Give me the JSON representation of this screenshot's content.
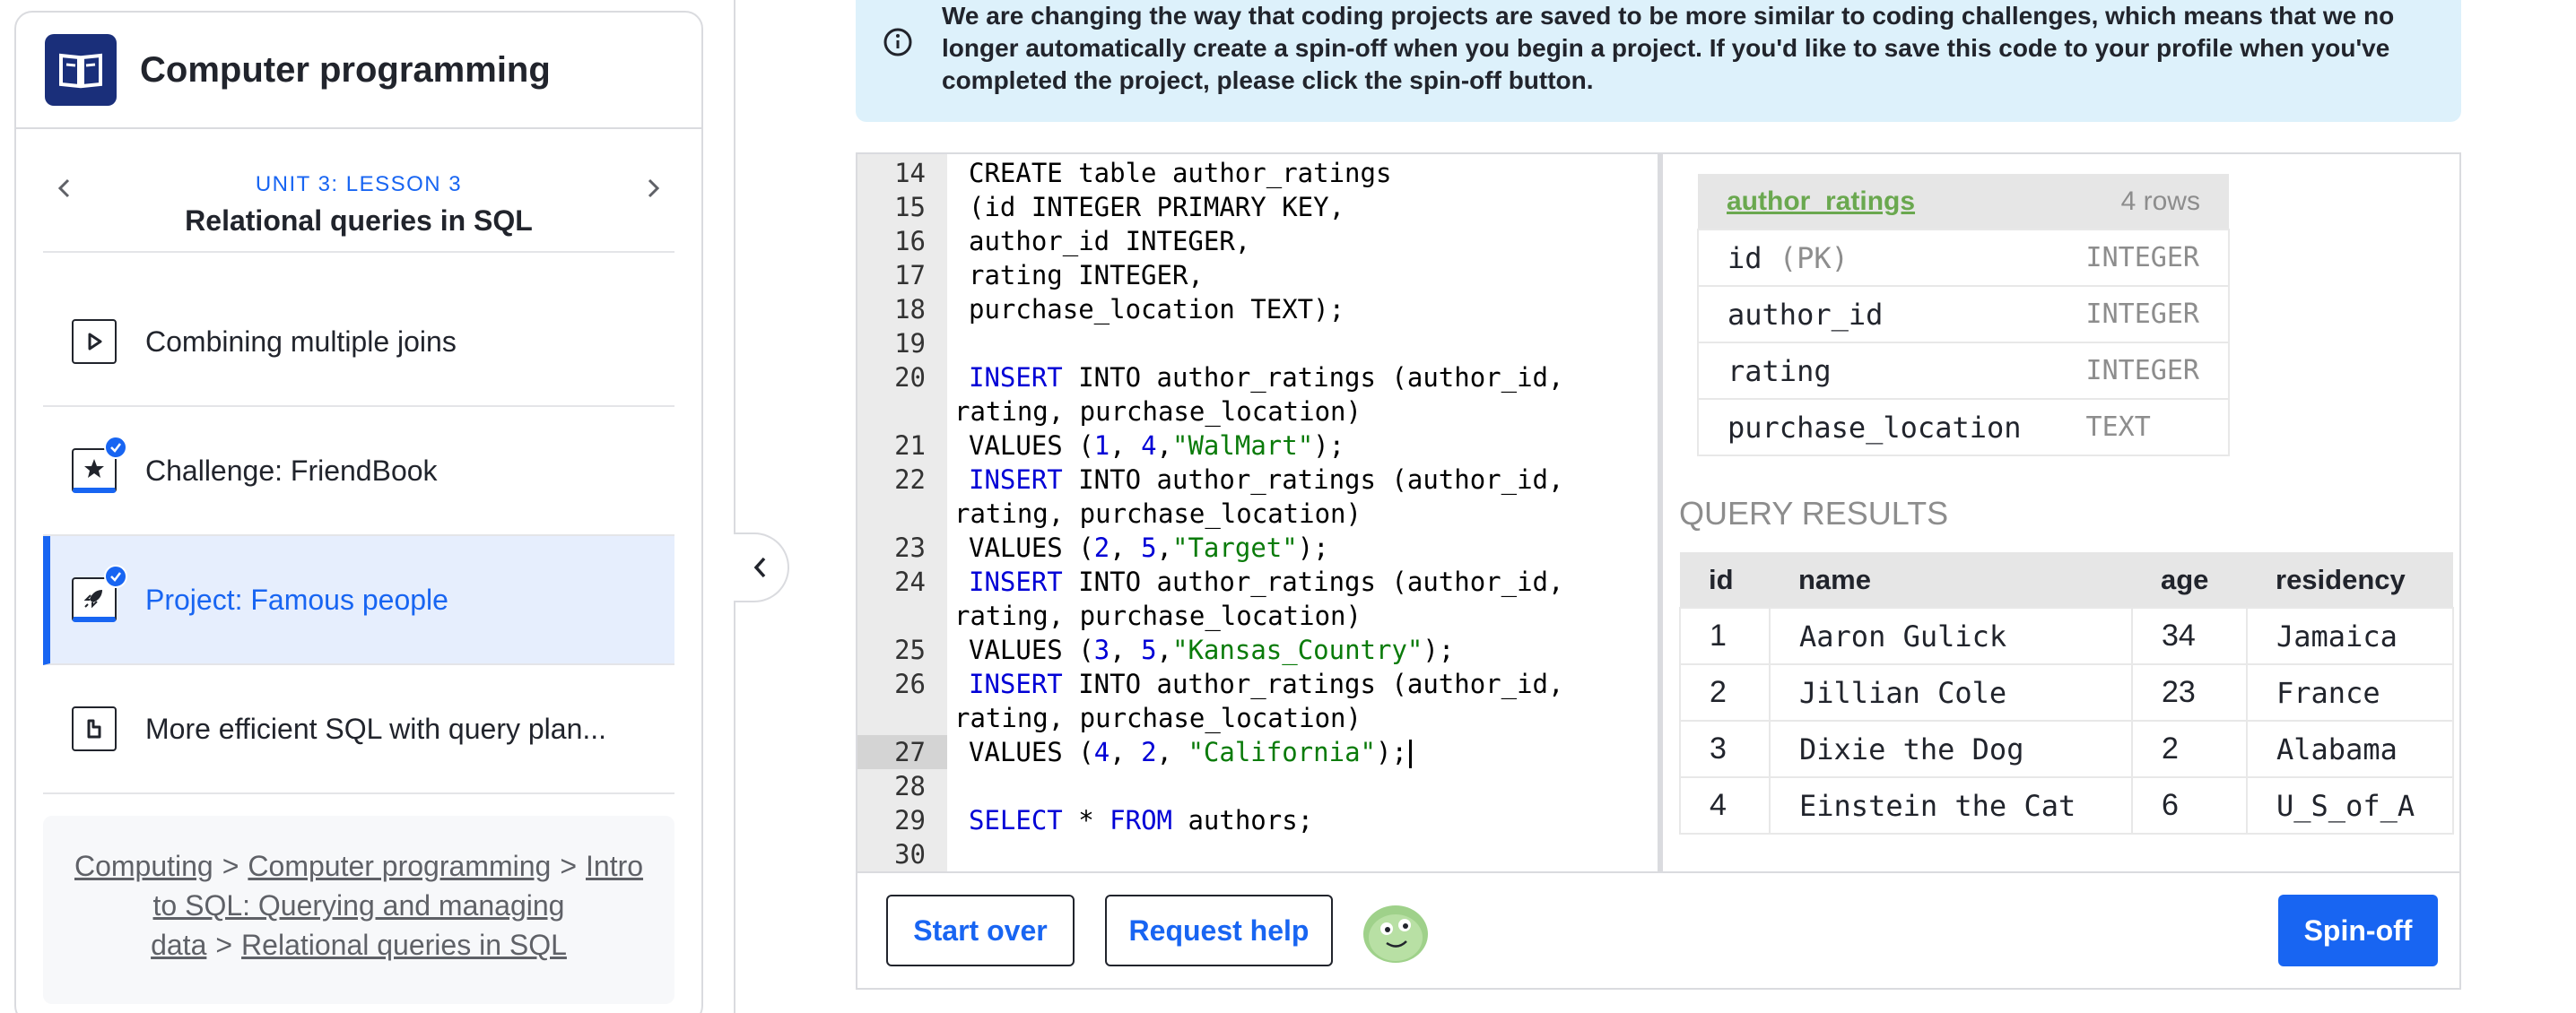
{
  "course": {
    "title": "Computer programming"
  },
  "lesson_nav": {
    "unit_label": "UNIT 3: LESSON 3",
    "lesson_title": "Relational queries in SQL"
  },
  "lessons": [
    {
      "label": "Combining multiple joins",
      "icon": "play-icon",
      "completed": false,
      "active": false
    },
    {
      "label": "Challenge: FriendBook",
      "icon": "star-icon",
      "completed": true,
      "active": false
    },
    {
      "label": "Project: Famous people",
      "icon": "rocket-icon",
      "completed": true,
      "active": true
    },
    {
      "label": "More efficient SQL with query plan...",
      "icon": "article-icon",
      "completed": false,
      "active": false
    }
  ],
  "breadcrumbs": {
    "items": [
      "Computing",
      "Computer programming",
      "Intro to SQL: Querying and managing data",
      "Relational queries in SQL"
    ],
    "separator": ">"
  },
  "banner": {
    "text": "We are changing the way that coding projects are saved to be more similar to coding challenges, which means that we no longer automatically create a spin-off when you begin a project. If you'd like to save this code to your profile when you've completed the project, please click the spin-off button."
  },
  "code": {
    "lines": [
      {
        "n": "14",
        "text": "CREATE table author_ratings"
      },
      {
        "n": "15",
        "text": "(id INTEGER PRIMARY KEY,"
      },
      {
        "n": "16",
        "text": "author_id INTEGER,"
      },
      {
        "n": "17",
        "text": "rating INTEGER,"
      },
      {
        "n": "18",
        "text": "purchase_location TEXT);"
      },
      {
        "n": "19",
        "text": ""
      },
      {
        "n": "20",
        "text": "INSERT INTO author_ratings (author_id, rating, purchase_location)"
      },
      {
        "n": "21",
        "text": "VALUES (1, 4,\"WalMart\");"
      },
      {
        "n": "22",
        "text": "INSERT INTO author_ratings (author_id, rating, purchase_location)"
      },
      {
        "n": "23",
        "text": "VALUES (2, 5,\"Target\");"
      },
      {
        "n": "24",
        "text": "INSERT INTO author_ratings (author_id, rating, purchase_location)"
      },
      {
        "n": "25",
        "text": "VALUES (3, 5,\"Kansas_Country\");"
      },
      {
        "n": "26",
        "text": "INSERT INTO author_ratings (author_id, rating, purchase_location)"
      },
      {
        "n": "27",
        "text": "VALUES (4, 2, \"California\");"
      },
      {
        "n": "28",
        "text": ""
      },
      {
        "n": "29",
        "text": "SELECT * FROM authors;"
      },
      {
        "n": "30",
        "text": ""
      }
    ],
    "active_line": "27"
  },
  "schema": {
    "table_name": "author_ratings",
    "row_count": "4 rows",
    "columns": [
      {
        "name": "id",
        "note": "(PK)",
        "type": "INTEGER"
      },
      {
        "name": "author_id",
        "note": "",
        "type": "INTEGER"
      },
      {
        "name": "rating",
        "note": "",
        "type": "INTEGER"
      },
      {
        "name": "purchase_location",
        "note": "",
        "type": "TEXT"
      }
    ]
  },
  "results": {
    "title": "QUERY RESULTS",
    "headers": [
      "id",
      "name",
      "age",
      "residency"
    ],
    "rows": [
      [
        "1",
        "Aaron Gulick",
        "34",
        "Jamaica"
      ],
      [
        "2",
        "Jillian Cole",
        "23",
        "France"
      ],
      [
        "3",
        "Dixie the Dog",
        "2",
        "Alabama"
      ],
      [
        "4",
        "Einstein the Cat",
        "6",
        "U_S_of_A"
      ]
    ]
  },
  "buttons": {
    "start_over": "Start over",
    "request_help": "Request help",
    "spin_off": "Spin-off"
  },
  "colors": {
    "accent": "#1865f2",
    "banner_bg": "#ddf1fb",
    "course_logo": "#1a2f7a",
    "table_name": "#6aa84f"
  }
}
